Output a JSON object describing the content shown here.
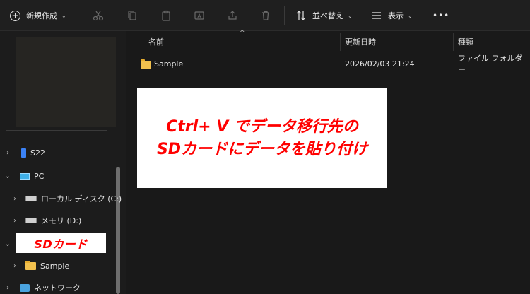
{
  "toolbar": {
    "new_label": "新規作成",
    "sort_label": "並べ替え",
    "view_label": "表示",
    "more_label": "•••"
  },
  "sidebar": {
    "items": [
      {
        "label": "S22"
      },
      {
        "label": "PC"
      },
      {
        "label": "ローカル ディスク (C:)"
      },
      {
        "label": "メモリ (D:)"
      },
      {
        "label": "SDカード"
      },
      {
        "label": "Sample"
      },
      {
        "label": "ネットワーク"
      }
    ]
  },
  "columns": {
    "name": "名前",
    "modified": "更新日時",
    "type": "種類"
  },
  "files": [
    {
      "name": "Sample",
      "modified": "2026/02/03 21:24",
      "type": "ファイル フォルダー"
    }
  ],
  "annotation": {
    "line1": "Ctrl+ V でデータ移行先の",
    "line2": "SDカードにデータを貼り付け"
  },
  "colors": {
    "annotation_text": "#ff0000",
    "folder": "#f2c14e",
    "background": "#191919"
  }
}
